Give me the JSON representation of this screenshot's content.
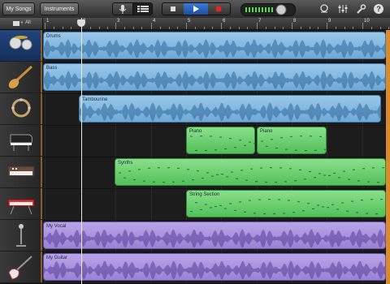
{
  "toolbar": {
    "my_songs": "My Songs",
    "instruments": "Instruments"
  },
  "ruler": {
    "all_label": "All",
    "bars": [
      "1",
      "2",
      "3",
      "4",
      "5",
      "6",
      "7",
      "8",
      "9",
      "10"
    ]
  },
  "tracks": [
    {
      "instrument": "drum-kit",
      "label": "Drums",
      "color": "blue"
    },
    {
      "instrument": "bass-guitar",
      "label": "Bass",
      "color": "blue"
    },
    {
      "instrument": "tambourine",
      "label": "Tambourine",
      "color": "blue"
    },
    {
      "instrument": "grand-piano",
      "label": "Piano",
      "color": "green"
    },
    {
      "instrument": "synthesizer",
      "label": "Synths",
      "color": "green"
    },
    {
      "instrument": "keyboard",
      "label": "String Section",
      "color": "green"
    },
    {
      "instrument": "microphone",
      "label": "My Vocal",
      "color": "purple"
    },
    {
      "instrument": "electric-guitar",
      "label": "My Guitar",
      "color": "purple"
    }
  ],
  "colors": {
    "blue": "#7fb6e0",
    "green": "#5dc466",
    "purple": "#a48cdc",
    "level_meter": "#55e04a"
  }
}
